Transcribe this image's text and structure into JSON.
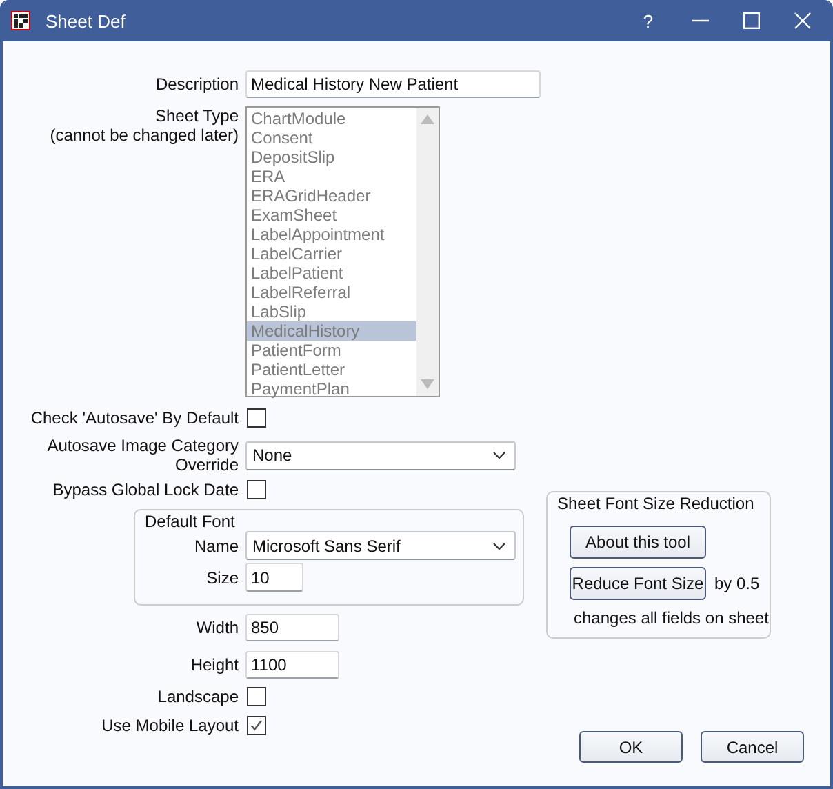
{
  "window": {
    "title": "Sheet Def",
    "help": "?"
  },
  "description": {
    "label": "Description",
    "value": "Medical History New Patient"
  },
  "sheet_type": {
    "label": "Sheet Type",
    "note": "(cannot be changed later)",
    "disabled": true,
    "items": [
      {
        "label": "ChartModule",
        "selected": false
      },
      {
        "label": "Consent",
        "selected": false
      },
      {
        "label": "DepositSlip",
        "selected": false
      },
      {
        "label": "ERA",
        "selected": false
      },
      {
        "label": "ERAGridHeader",
        "selected": false
      },
      {
        "label": "ExamSheet",
        "selected": false
      },
      {
        "label": "LabelAppointment",
        "selected": false
      },
      {
        "label": "LabelCarrier",
        "selected": false
      },
      {
        "label": "LabelPatient",
        "selected": false
      },
      {
        "label": "LabelReferral",
        "selected": false
      },
      {
        "label": "LabSlip",
        "selected": false
      },
      {
        "label": "MedicalHistory",
        "selected": true
      },
      {
        "label": "PatientForm",
        "selected": false
      },
      {
        "label": "PatientLetter",
        "selected": false
      },
      {
        "label": "PaymentPlan",
        "selected": false
      }
    ]
  },
  "check_autosave": {
    "label": "Check 'Autosave' By Default",
    "checked": false
  },
  "autosave_category": {
    "label_lines": [
      "Autosave Image Category",
      "Override"
    ],
    "value": "None"
  },
  "bypass_lock": {
    "label": "Bypass Global Lock Date",
    "checked": false
  },
  "default_font": {
    "title": "Default Font",
    "name_label": "Name",
    "name_value": "Microsoft Sans Serif",
    "size_label": "Size",
    "size_value": "10"
  },
  "width": {
    "label": "Width",
    "value": "850"
  },
  "height": {
    "label": "Height",
    "value": "1100"
  },
  "landscape": {
    "label": "Landscape",
    "checked": false
  },
  "mobile_layout": {
    "label": "Use Mobile Layout",
    "checked": true
  },
  "font_reduction": {
    "title": "Sheet Font Size Reduction",
    "about_button": "About this tool",
    "reduce_button": "Reduce Font Size",
    "amount": "by 0.5",
    "note": "changes all fields on sheet"
  },
  "buttons": [
    "OK",
    "Cancel"
  ]
}
